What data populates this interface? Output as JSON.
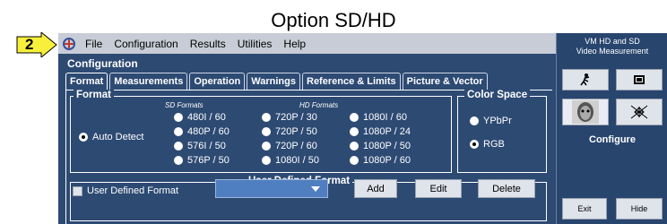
{
  "caption": "Option SD/HD",
  "callout": {
    "number": "2"
  },
  "menubar": {
    "items": [
      "File",
      "Configuration",
      "Results",
      "Utilities",
      "Help"
    ]
  },
  "config_title": "Configuration",
  "tabs": [
    "Format",
    "Measurements",
    "Operation",
    "Warnings",
    "Reference & Limits",
    "Picture & Vector"
  ],
  "active_tab": "Format",
  "format_group": {
    "label": "Format",
    "auto_detect": "Auto Detect",
    "sd_heading": "SD Formats",
    "hd_heading": "HD Formats",
    "sd_formats": [
      "480I / 60",
      "480P / 60",
      "576I / 50",
      "576P / 50"
    ],
    "hd_col1": [
      "720P / 30",
      "720P / 50",
      "720P / 60",
      "1080I / 50"
    ],
    "hd_col2": [
      "1080I / 60",
      "1080P / 24",
      "1080P / 50",
      "1080P / 60"
    ]
  },
  "color_space": {
    "label": "Color Space",
    "options": [
      "YPbPr",
      "RGB"
    ],
    "selected": "RGB"
  },
  "user_defined": {
    "label": "User Defined Format",
    "checkbox_label": "User Defined Format",
    "add": "Add",
    "edit": "Edit",
    "delete": "Delete"
  },
  "right_panel": {
    "title_line1": "VM HD and SD",
    "title_line2": "Video Measurement",
    "configure": "Configure",
    "exit": "Exit",
    "hide": "Hide"
  },
  "colors": {
    "app_bg": "#2d4a73",
    "menubar_bg": "#c7ccd6",
    "callout_yellow": "#f7ef3a"
  }
}
